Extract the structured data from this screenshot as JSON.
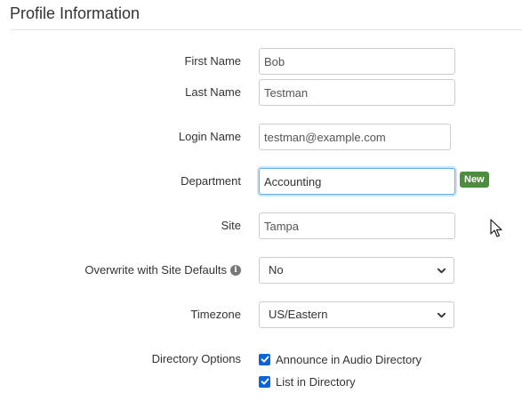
{
  "section": {
    "title": "Profile Information"
  },
  "fields": {
    "first_name": {
      "label": "First Name",
      "value": "Bob"
    },
    "last_name": {
      "label": "Last Name",
      "value": "Testman"
    },
    "login_name": {
      "label": "Login Name",
      "value": "testman@example.com"
    },
    "department": {
      "label": "Department",
      "value": "Accounting",
      "badge": "New"
    },
    "site": {
      "label": "Site",
      "value": "Tampa"
    },
    "overwrite_site_defaults": {
      "label": "Overwrite with Site Defaults",
      "value": "No",
      "info_icon": "info-icon"
    },
    "timezone": {
      "label": "Timezone",
      "value": "US/Eastern"
    }
  },
  "directory_options": {
    "label": "Directory Options",
    "options": [
      {
        "label": "Announce in Audio Directory",
        "checked": true
      },
      {
        "label": "List in Directory",
        "checked": true
      }
    ]
  },
  "colors": {
    "badge_green": "#4e8c3f",
    "checkbox_blue": "#0b63d6",
    "focus_border": "#66afe9"
  }
}
